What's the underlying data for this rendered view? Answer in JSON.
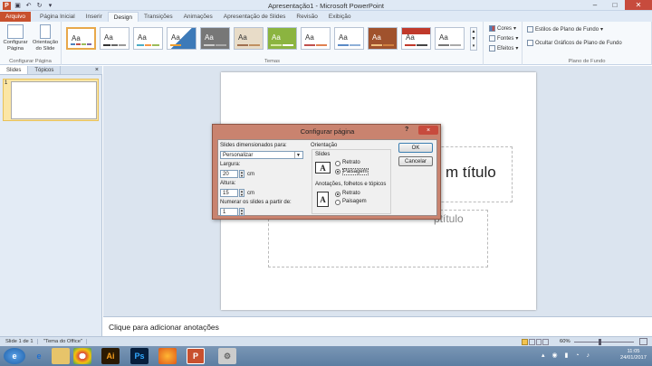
{
  "window": {
    "title": "Apresentação1 - Microsoft PowerPoint"
  },
  "tabs": [
    "Arquivo",
    "Página Inicial",
    "Inserir",
    "Design",
    "Transições",
    "Animações",
    "Apresentação de Slides",
    "Revisão",
    "Exibição"
  ],
  "ribbon": {
    "page_setup": {
      "btn1_l1": "Configurar",
      "btn1_l2": "Página",
      "btn2_l1": "Orientação",
      "btn2_l2": "do Slide",
      "label": "Configurar Página"
    },
    "themes_label": "Temas",
    "theme_text": "Aa",
    "cores": "Cores",
    "fontes": "Fontes",
    "efeitos": "Efeitos",
    "estilos": "Estilos de Plano de Fundo",
    "ocultar": "Ocultar Gráficos de Plano de Fundo",
    "bg_label": "Plano de Fundo"
  },
  "left_pane": {
    "tab_slides": "Slides",
    "tab_topics": "Tópicos",
    "close": "×",
    "slide_number": "1"
  },
  "slide": {
    "title_visible": "m título",
    "subtitle_visible": "ptítulo"
  },
  "notes": {
    "placeholder": "Clique para adicionar anotações"
  },
  "status": {
    "slide_count": "Slide 1 de 1",
    "theme": "\"Tema do Office\"",
    "zoom": "60%"
  },
  "dialog": {
    "title": "Configurar página",
    "help": "?",
    "close": "×",
    "sized_label": "Slides dimensionados para:",
    "sized_value": "Personalizar",
    "width_label": "Largura:",
    "width_value": "20",
    "height_label": "Altura:",
    "height_value": "15",
    "unit": "cm",
    "number_label": "Numerar os slides a partir de:",
    "number_value": "1",
    "orientation_label": "Orientação",
    "slides_label": "Slides",
    "portrait": "Retrato",
    "landscape": "Paisagem",
    "notes_label": "Anotações, folhetos e tópicos",
    "ok": "OK",
    "cancel": "Cancelar"
  },
  "taskbar": {
    "time": "11:05",
    "date": "24/01/2017"
  },
  "colors": {
    "file_tab": "#c8502e",
    "dialog_frame": "#c9836f",
    "close_red": "#c74b3d"
  }
}
